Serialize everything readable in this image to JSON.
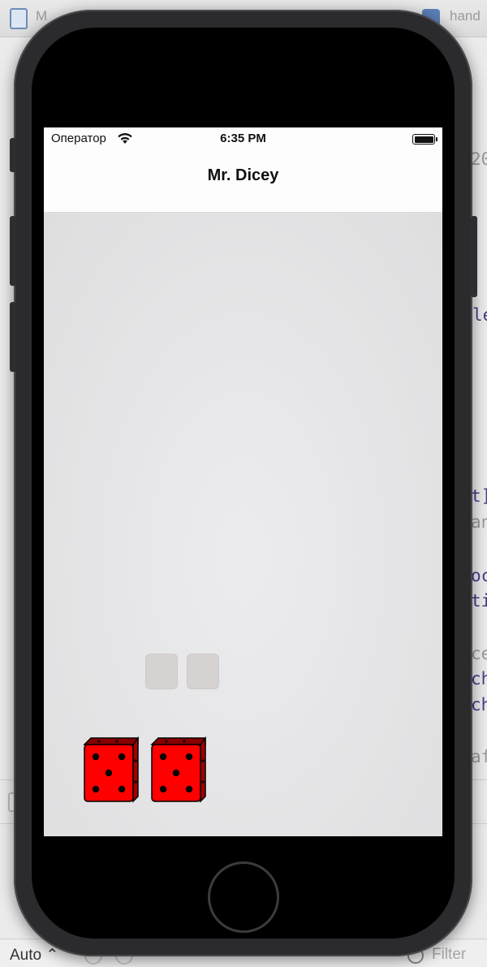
{
  "ide": {
    "crumbs": [
      "M",
      "hand"
    ],
    "code_fragments": [
      "20",
      "le",
      "t]",
      "an",
      "oc",
      "ti",
      "ce",
      "ch",
      "ch",
      "af"
    ],
    "bottom_bar": {
      "mode_label": "Auto ⌃",
      "filter_placeholder": "Filter"
    }
  },
  "status_bar": {
    "carrier": "Оператор",
    "time": "6:35 PM",
    "wifi_icon": "wifi-icon",
    "battery_icon": "battery-full-icon",
    "battery_level": 1.0
  },
  "nav": {
    "title": "Mr. Dicey"
  },
  "dice": {
    "ghost_count": 2,
    "faces": [
      5,
      5
    ],
    "die_color": "#ff0000",
    "pip_color": "#000000"
  },
  "icons": {
    "cursor": "arrow-cursor-icon",
    "home": "home-button-icon"
  }
}
